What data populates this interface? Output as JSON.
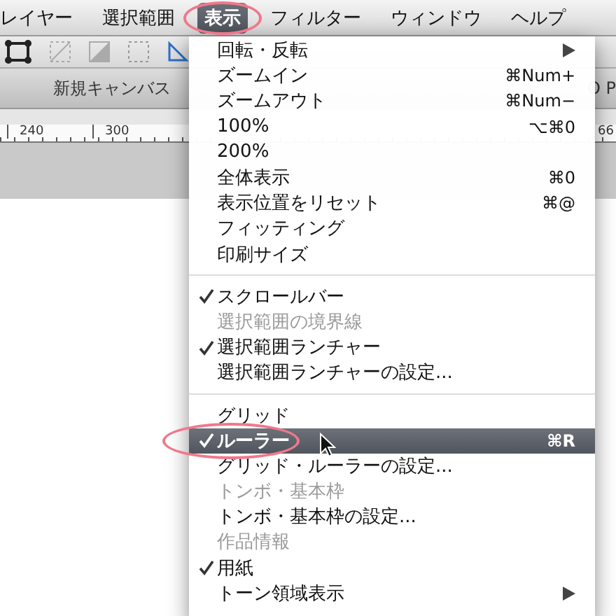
{
  "menubar": [
    {
      "label": "レイヤー",
      "selected": false
    },
    {
      "label": "選択範囲",
      "selected": false
    },
    {
      "label": "表示",
      "selected": true
    },
    {
      "label": "フィルター",
      "selected": false
    },
    {
      "label": "ウィンドウ",
      "selected": false
    },
    {
      "label": "ヘルプ",
      "selected": false
    }
  ],
  "document_title": {
    "left": "新規キャンバス",
    "right": "O P"
  },
  "ruler": {
    "labels": [
      "240",
      "300"
    ],
    "right_label": "66"
  },
  "menu": [
    {
      "kind": "item",
      "label": "回転・反転",
      "checked": false,
      "disabled": false,
      "submenu": true,
      "selected": false
    },
    {
      "kind": "item",
      "label": "ズームイン",
      "shortcut": "⌘Num+",
      "checked": false,
      "disabled": false,
      "submenu": false,
      "selected": false
    },
    {
      "kind": "item",
      "label": "ズームアウト",
      "shortcut": "⌘Num−",
      "checked": false,
      "disabled": false,
      "submenu": false,
      "selected": false
    },
    {
      "kind": "item",
      "label": "100%",
      "shortcut": "⌥⌘0",
      "checked": false,
      "disabled": false,
      "submenu": false,
      "selected": false
    },
    {
      "kind": "item",
      "label": "200%",
      "checked": false,
      "disabled": false,
      "submenu": false,
      "selected": false
    },
    {
      "kind": "item",
      "label": "全体表示",
      "shortcut": "⌘0",
      "checked": false,
      "disabled": false,
      "submenu": false,
      "selected": false
    },
    {
      "kind": "item",
      "label": "表示位置をリセット",
      "shortcut": "⌘@",
      "checked": false,
      "disabled": false,
      "submenu": false,
      "selected": false
    },
    {
      "kind": "item",
      "label": "フィッティング",
      "checked": false,
      "disabled": false,
      "submenu": false,
      "selected": false
    },
    {
      "kind": "item",
      "label": "印刷サイズ",
      "checked": false,
      "disabled": false,
      "submenu": false,
      "selected": false
    },
    {
      "kind": "separator"
    },
    {
      "kind": "item",
      "label": "スクロールバー",
      "checked": true,
      "disabled": false,
      "submenu": false,
      "selected": false
    },
    {
      "kind": "item",
      "label": "選択範囲の境界線",
      "checked": false,
      "disabled": true,
      "submenu": false,
      "selected": false
    },
    {
      "kind": "item",
      "label": "選択範囲ランチャー",
      "checked": true,
      "disabled": false,
      "submenu": false,
      "selected": false
    },
    {
      "kind": "item",
      "label": "選択範囲ランチャーの設定...",
      "checked": false,
      "disabled": false,
      "submenu": false,
      "selected": false
    },
    {
      "kind": "separator"
    },
    {
      "kind": "item",
      "label": "グリッド",
      "checked": false,
      "disabled": false,
      "submenu": false,
      "selected": false
    },
    {
      "kind": "item",
      "label": "ルーラー",
      "shortcut": "⌘R",
      "checked": true,
      "disabled": false,
      "submenu": false,
      "selected": true
    },
    {
      "kind": "item",
      "label": "グリッド・ルーラーの設定...",
      "checked": false,
      "disabled": false,
      "submenu": false,
      "selected": false
    },
    {
      "kind": "item",
      "label": "トンボ・基本枠",
      "checked": false,
      "disabled": true,
      "submenu": false,
      "selected": false
    },
    {
      "kind": "item",
      "label": "トンボ・基本枠の設定...",
      "checked": false,
      "disabled": false,
      "submenu": false,
      "selected": false
    },
    {
      "kind": "item",
      "label": "作品情報",
      "checked": false,
      "disabled": true,
      "submenu": false,
      "selected": false
    },
    {
      "kind": "item",
      "label": "用紙",
      "checked": true,
      "disabled": false,
      "submenu": false,
      "selected": false
    },
    {
      "kind": "item",
      "label": "トーン領域表示",
      "checked": false,
      "disabled": false,
      "submenu": true,
      "selected": false
    }
  ]
}
